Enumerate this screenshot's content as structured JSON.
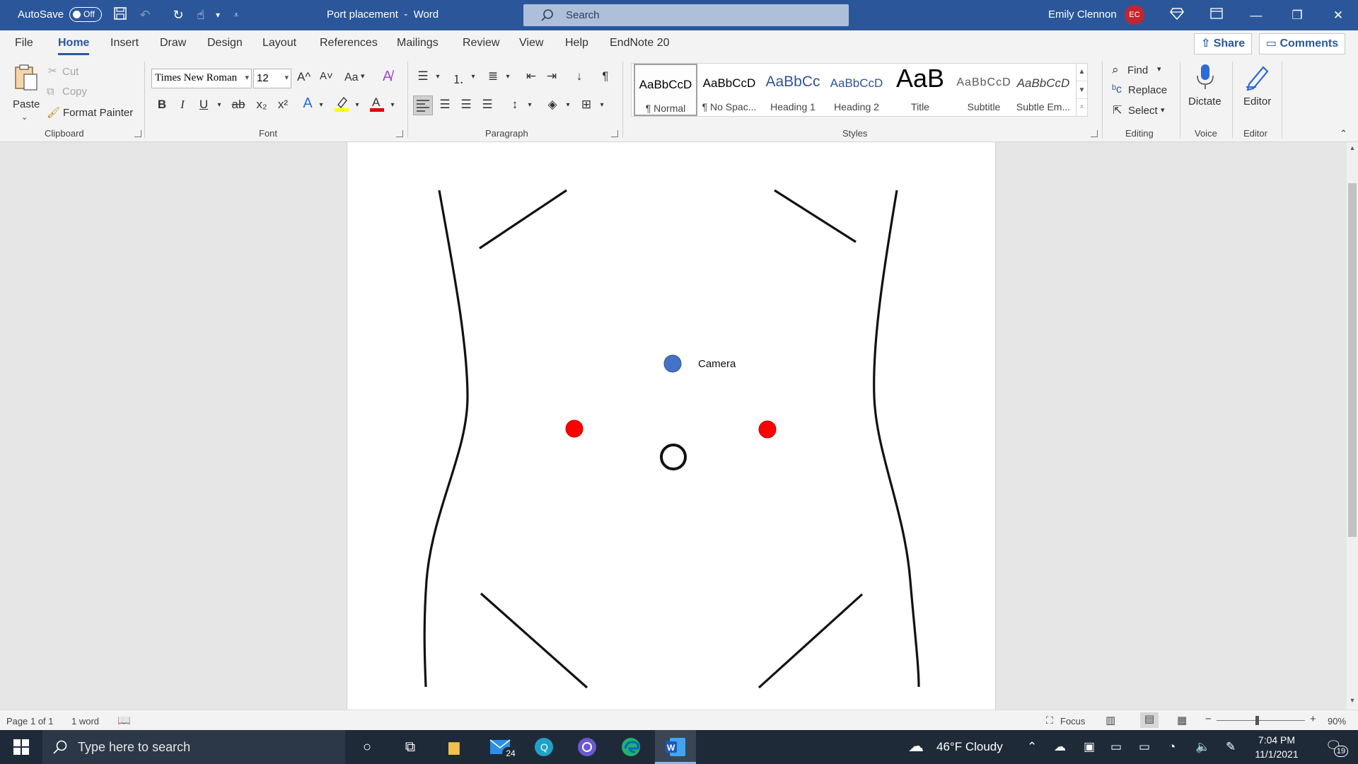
{
  "titlebar": {
    "autosave_label": "AutoSave",
    "autosave_state": "Off",
    "document_title": "Port placement",
    "app_separator": "-",
    "app_name": "Word",
    "search_placeholder": "Search",
    "user_name": "Emily Clennon",
    "user_initials": "EC"
  },
  "ribbon_tabs": [
    "File",
    "Home",
    "Insert",
    "Draw",
    "Design",
    "Layout",
    "References",
    "Mailings",
    "Review",
    "View",
    "Help",
    "EndNote 20"
  ],
  "ribbon_active_tab": "Home",
  "share_label": "Share",
  "comments_label": "Comments",
  "clipboard": {
    "paste": "Paste",
    "cut": "Cut",
    "copy": "Copy",
    "format_painter": "Format Painter",
    "group_label": "Clipboard"
  },
  "font": {
    "family": "Times New Roman",
    "size": "12",
    "group_label": "Font",
    "grow": "A^",
    "shrink": "A˅",
    "case": "Aa",
    "bold": "B",
    "italic": "I",
    "underline": "U",
    "strike": "ab",
    "subscript": "x₂",
    "superscript": "x²"
  },
  "paragraph": {
    "group_label": "Paragraph",
    "pilcrow": "¶"
  },
  "styles": {
    "group_label": "Styles",
    "items": [
      {
        "preview": "AaBbCcD",
        "name": "¶ Normal",
        "color": "#000000",
        "selected": true
      },
      {
        "preview": "AaBbCcD",
        "name": "¶ No Spac...",
        "color": "#000000",
        "selected": false
      },
      {
        "preview": "AaBbCc",
        "name": "Heading 1",
        "color": "#2f5496",
        "selected": false
      },
      {
        "preview": "AaBbCcD",
        "name": "Heading 2",
        "color": "#2f5496",
        "selected": false
      },
      {
        "preview": "AaB",
        "name": "Title",
        "color": "#000000",
        "selected": false
      },
      {
        "preview": "AaBbCcD",
        "name": "Subtitle",
        "color": "#595959",
        "selected": false
      },
      {
        "preview": "AaBbCcD",
        "name": "Subtle Em...",
        "color": "#404040",
        "selected": false
      }
    ]
  },
  "editing": {
    "find": "Find",
    "replace": "Replace",
    "select": "Select",
    "group_label": "Editing"
  },
  "voice": {
    "dictate": "Dictate",
    "group_label": "Voice"
  },
  "editor": {
    "label": "Editor",
    "group_label": "Editor"
  },
  "document": {
    "camera_label": "Camera",
    "camera_port_color": "#4472c4",
    "working_port_color": "#ff0000"
  },
  "statusbar": {
    "page": "Page 1 of 1",
    "words": "1 word",
    "focus": "Focus",
    "zoom": "90%"
  },
  "taskbar": {
    "search_placeholder": "Type here to search",
    "mail_badge": "24",
    "weather": "46°F  Cloudy",
    "time": "7:04 PM",
    "date": "11/1/2021",
    "notifications": "19"
  },
  "colors": {
    "word_blue": "#2b579a",
    "taskbar": "#1f2a38"
  }
}
